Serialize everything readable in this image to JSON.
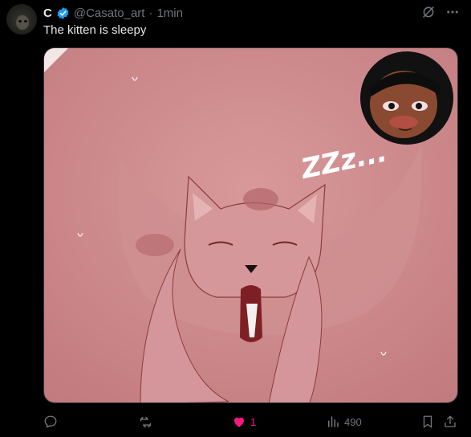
{
  "post": {
    "display_name": "C",
    "handle": "@Casato_art",
    "separator": "·",
    "time": "1min",
    "text": "The kitten is sleepy"
  },
  "media": {
    "sleep_text": "ZZz..."
  },
  "actions": {
    "like_count": "1",
    "view_count": "490"
  },
  "colors": {
    "background": "#000000",
    "text": "#e7e9ea",
    "muted": "#71767b",
    "verified_blue": "#1d9bf0",
    "like_pink": "#f91880",
    "artwork_pink": "#c97f82"
  },
  "icons": {
    "verified": "verified-badge-icon",
    "grok": "grok-icon",
    "more": "more-icon",
    "reply": "reply-icon",
    "repost": "repost-icon",
    "like": "heart-icon",
    "views": "views-icon",
    "bookmark": "bookmark-icon",
    "share": "share-icon"
  }
}
